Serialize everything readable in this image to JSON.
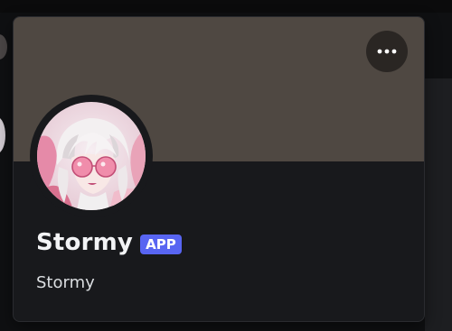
{
  "profile": {
    "display_name": "Stormy",
    "badge": "APP",
    "username": "Stormy",
    "more_icon": "ellipsis-icon",
    "avatar_icon": "avatar-image"
  },
  "colors": {
    "banner": "#4f4842",
    "card_background": "#18191c",
    "badge": "#5865f2",
    "name_text": "#f2f3f5"
  }
}
